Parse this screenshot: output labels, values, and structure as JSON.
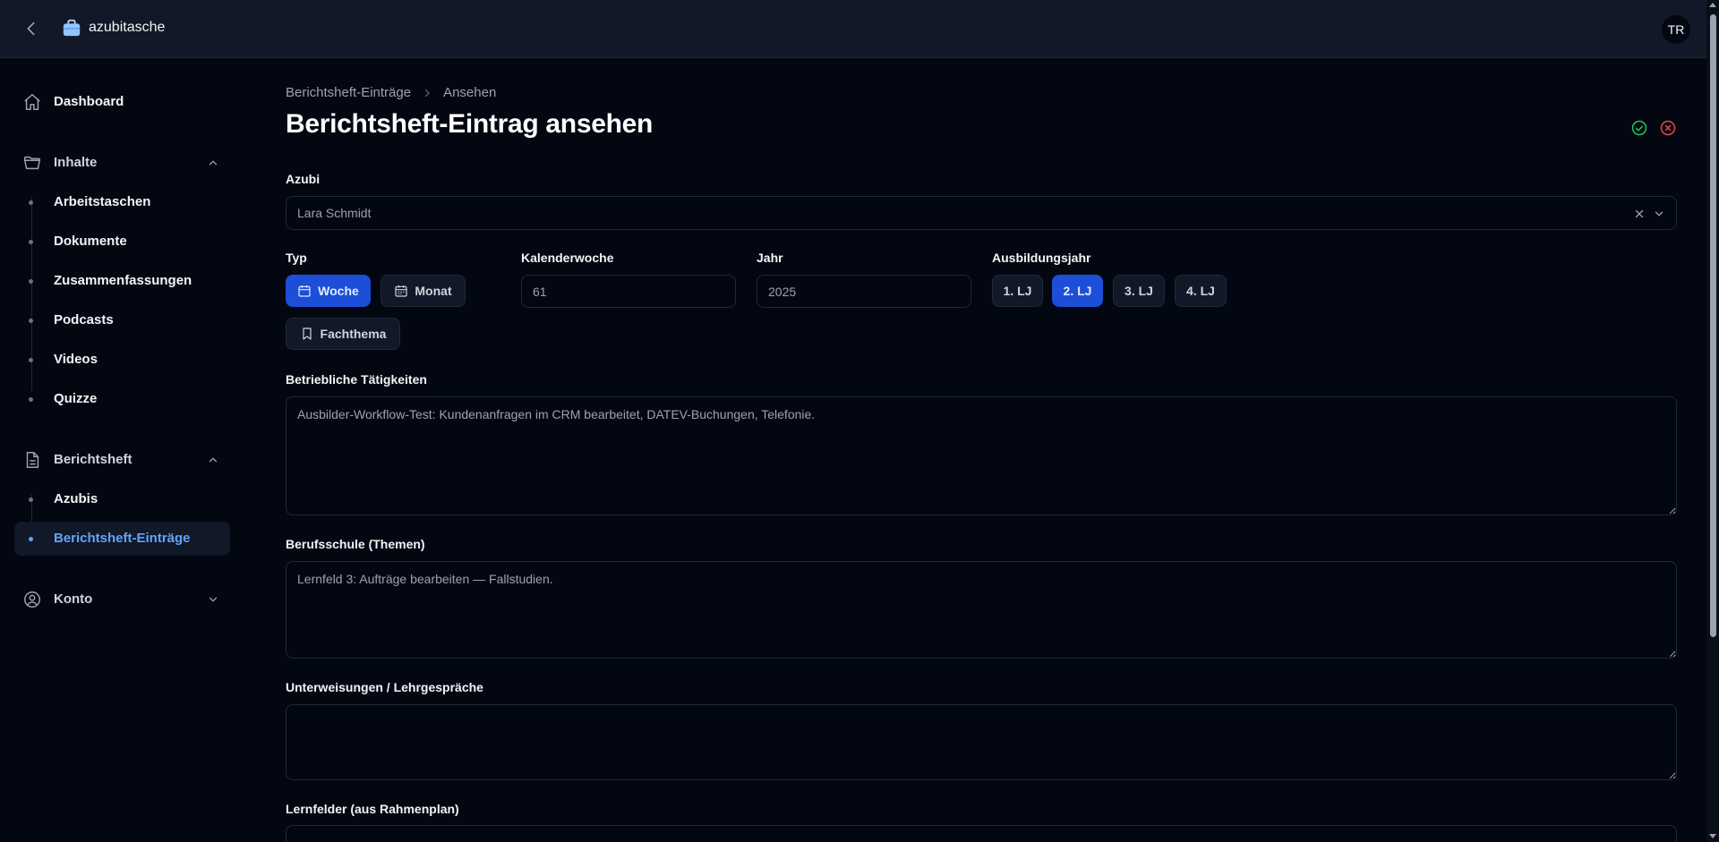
{
  "app": {
    "name": "azubitasche",
    "user_initials": "TR"
  },
  "sidebar": {
    "dashboard": "Dashboard",
    "inhalte": {
      "label": "Inhalte",
      "items": [
        "Arbeitstaschen",
        "Dokumente",
        "Zusammenfassungen",
        "Podcasts",
        "Videos",
        "Quizze"
      ]
    },
    "berichtsheft": {
      "label": "Berichtsheft",
      "items": [
        "Azubis",
        "Berichtsheft-Einträge"
      ],
      "active_item": "Berichtsheft-Einträge"
    },
    "konto": "Konto"
  },
  "breadcrumb": [
    "Berichtsheft-Einträge",
    "Ansehen"
  ],
  "page": {
    "title": "Berichtsheft-Eintrag ansehen"
  },
  "colors": {
    "accent": "#1d4ed8",
    "approve": "#22c55e",
    "reject": "#ef4444",
    "active_link": "#60a5fa"
  },
  "icons": {
    "approve": "check-circle-icon",
    "reject": "x-circle-icon"
  },
  "form": {
    "azubi": {
      "label": "Azubi",
      "value": "Lara Schmidt"
    },
    "typ": {
      "label": "Typ",
      "options": [
        "Woche",
        "Monat",
        "Fachthema"
      ],
      "selected": "Woche"
    },
    "kalenderwoche": {
      "label": "Kalenderwoche",
      "value": "61"
    },
    "jahr": {
      "label": "Jahr",
      "value": "2025"
    },
    "ausbildungsjahr": {
      "label": "Ausbildungsjahr",
      "options": [
        "1. LJ",
        "2. LJ",
        "3. LJ",
        "4. LJ"
      ],
      "selected": "2. LJ"
    },
    "betriebliche_taetigkeiten": {
      "label": "Betriebliche Tätigkeiten",
      "value": "Ausbilder-Workflow-Test: Kundenanfragen im CRM bearbeitet, DATEV-Buchungen, Telefonie."
    },
    "berufsschule": {
      "label": "Berufsschule (Themen)",
      "value": "Lernfeld 3: Aufträge bearbeiten — Fallstudien."
    },
    "unterweisungen": {
      "label": "Unterweisungen / Lehrgespräche",
      "value": ""
    },
    "lernfelder": {
      "label": "Lernfelder (aus Rahmenplan)"
    }
  }
}
